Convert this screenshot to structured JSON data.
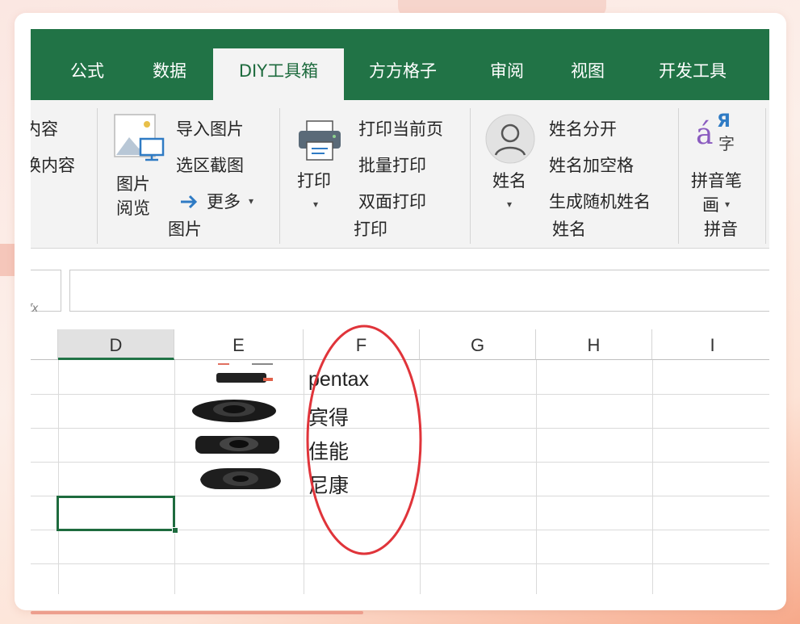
{
  "tabs": [
    {
      "label": "公式"
    },
    {
      "label": "数据"
    },
    {
      "label": "DIY工具箱"
    },
    {
      "label": "方方格子"
    },
    {
      "label": "审阅"
    },
    {
      "label": "视图"
    },
    {
      "label": "开发工具"
    }
  ],
  "active_tab": "DIY工具箱",
  "ribbon": {
    "partial_group": {
      "items": [
        "内容",
        "换内容"
      ]
    },
    "picture_group": {
      "big_button": "图片\n阅览",
      "big_button_line1": "图片",
      "big_button_line2": "阅览",
      "items": [
        "导入图片",
        "选区截图"
      ],
      "more": "更多",
      "label": "图片"
    },
    "print_group": {
      "big_button": "打印",
      "items": [
        "打印当前页",
        "批量打印",
        "双面打印"
      ],
      "label": "打印"
    },
    "name_group": {
      "big_button": "姓名",
      "items": [
        "姓名分开",
        "姓名加空格",
        "生成随机姓名"
      ],
      "label": "姓名"
    },
    "pinyin_group": {
      "big_button_line1": "拼音笔",
      "big_button_line2": "画",
      "icon_text_a": "á",
      "icon_text_ya": "Я",
      "icon_text_zi": "字",
      "label": "拼音"
    }
  },
  "formula_bar": {
    "value": ""
  },
  "columns": [
    "D",
    "E",
    "F",
    "G",
    "H",
    "I"
  ],
  "selected_column": "D",
  "cells": {
    "F": [
      "pentax",
      "宾得",
      "佳能",
      "尼康"
    ]
  },
  "colors": {
    "ribbon_green": "#217346",
    "annotation_red": "#e0343a"
  }
}
